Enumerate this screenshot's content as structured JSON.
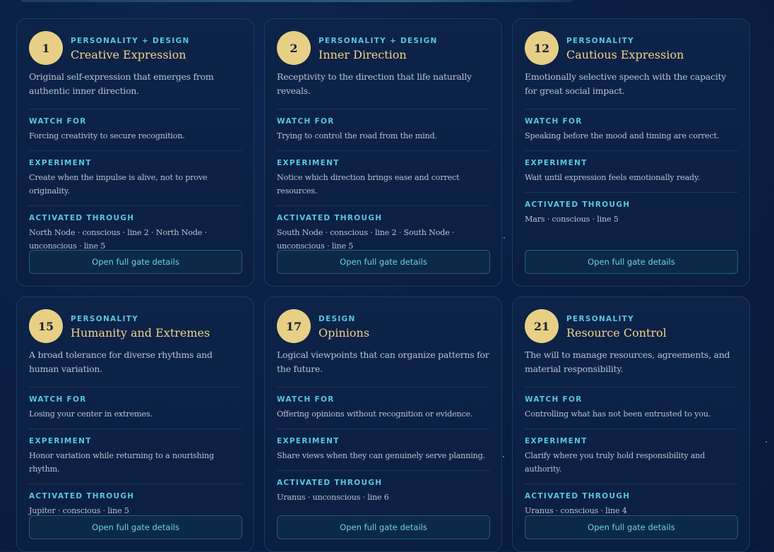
{
  "labels": {
    "watch_for": "WATCH FOR",
    "experiment": "EXPERIMENT",
    "activated_through": "ACTIVATED THROUGH",
    "open_details": "Open full gate details"
  },
  "cards": [
    {
      "number": "1",
      "kind": "PERSONALITY + DESIGN",
      "name": "Creative Expression",
      "description": "Original self-expression that emerges from authentic inner direction.",
      "watch_for": "Forcing creativity to secure recognition.",
      "experiment": "Create when the impulse is alive, not to prove originality.",
      "activated_through": "North Node · conscious · line 2 · North Node · unconscious · line 5"
    },
    {
      "number": "2",
      "kind": "PERSONALITY + DESIGN",
      "name": "Inner Direction",
      "description": "Receptivity to the direction that life naturally reveals.",
      "watch_for": "Trying to control the road from the mind.",
      "experiment": "Notice which direction brings ease and correct resources.",
      "activated_through": "South Node · conscious · line 2 · South Node · unconscious · line 5"
    },
    {
      "number": "12",
      "kind": "PERSONALITY",
      "name": "Cautious Expression",
      "description": "Emotionally selective speech with the capacity for great social impact.",
      "watch_for": "Speaking before the mood and timing are correct.",
      "experiment": "Wait until expression feels emotionally ready.",
      "activated_through": "Mars · conscious · line 5"
    },
    {
      "number": "15",
      "kind": "PERSONALITY",
      "name": "Humanity and Extremes",
      "description": "A broad tolerance for diverse rhythms and human variation.",
      "watch_for": "Losing your center in extremes.",
      "experiment": "Honor variation while returning to a nourishing rhythm.",
      "activated_through": "Jupiter · conscious · line 5"
    },
    {
      "number": "17",
      "kind": "DESIGN",
      "name": "Opinions",
      "description": "Logical viewpoints that can organize patterns for the future.",
      "watch_for": "Offering opinions without recognition or evidence.",
      "experiment": "Share views when they can genuinely serve planning.",
      "activated_through": "Uranus · unconscious · line 6"
    },
    {
      "number": "21",
      "kind": "PERSONALITY",
      "name": "Resource Control",
      "description": "The will to manage resources, agreements, and material responsibility.",
      "watch_for": "Controlling what has not been entrusted to you.",
      "experiment": "Clarify where you truly hold responsibility and authority.",
      "activated_through": "Uranus · conscious · line 4"
    }
  ]
}
